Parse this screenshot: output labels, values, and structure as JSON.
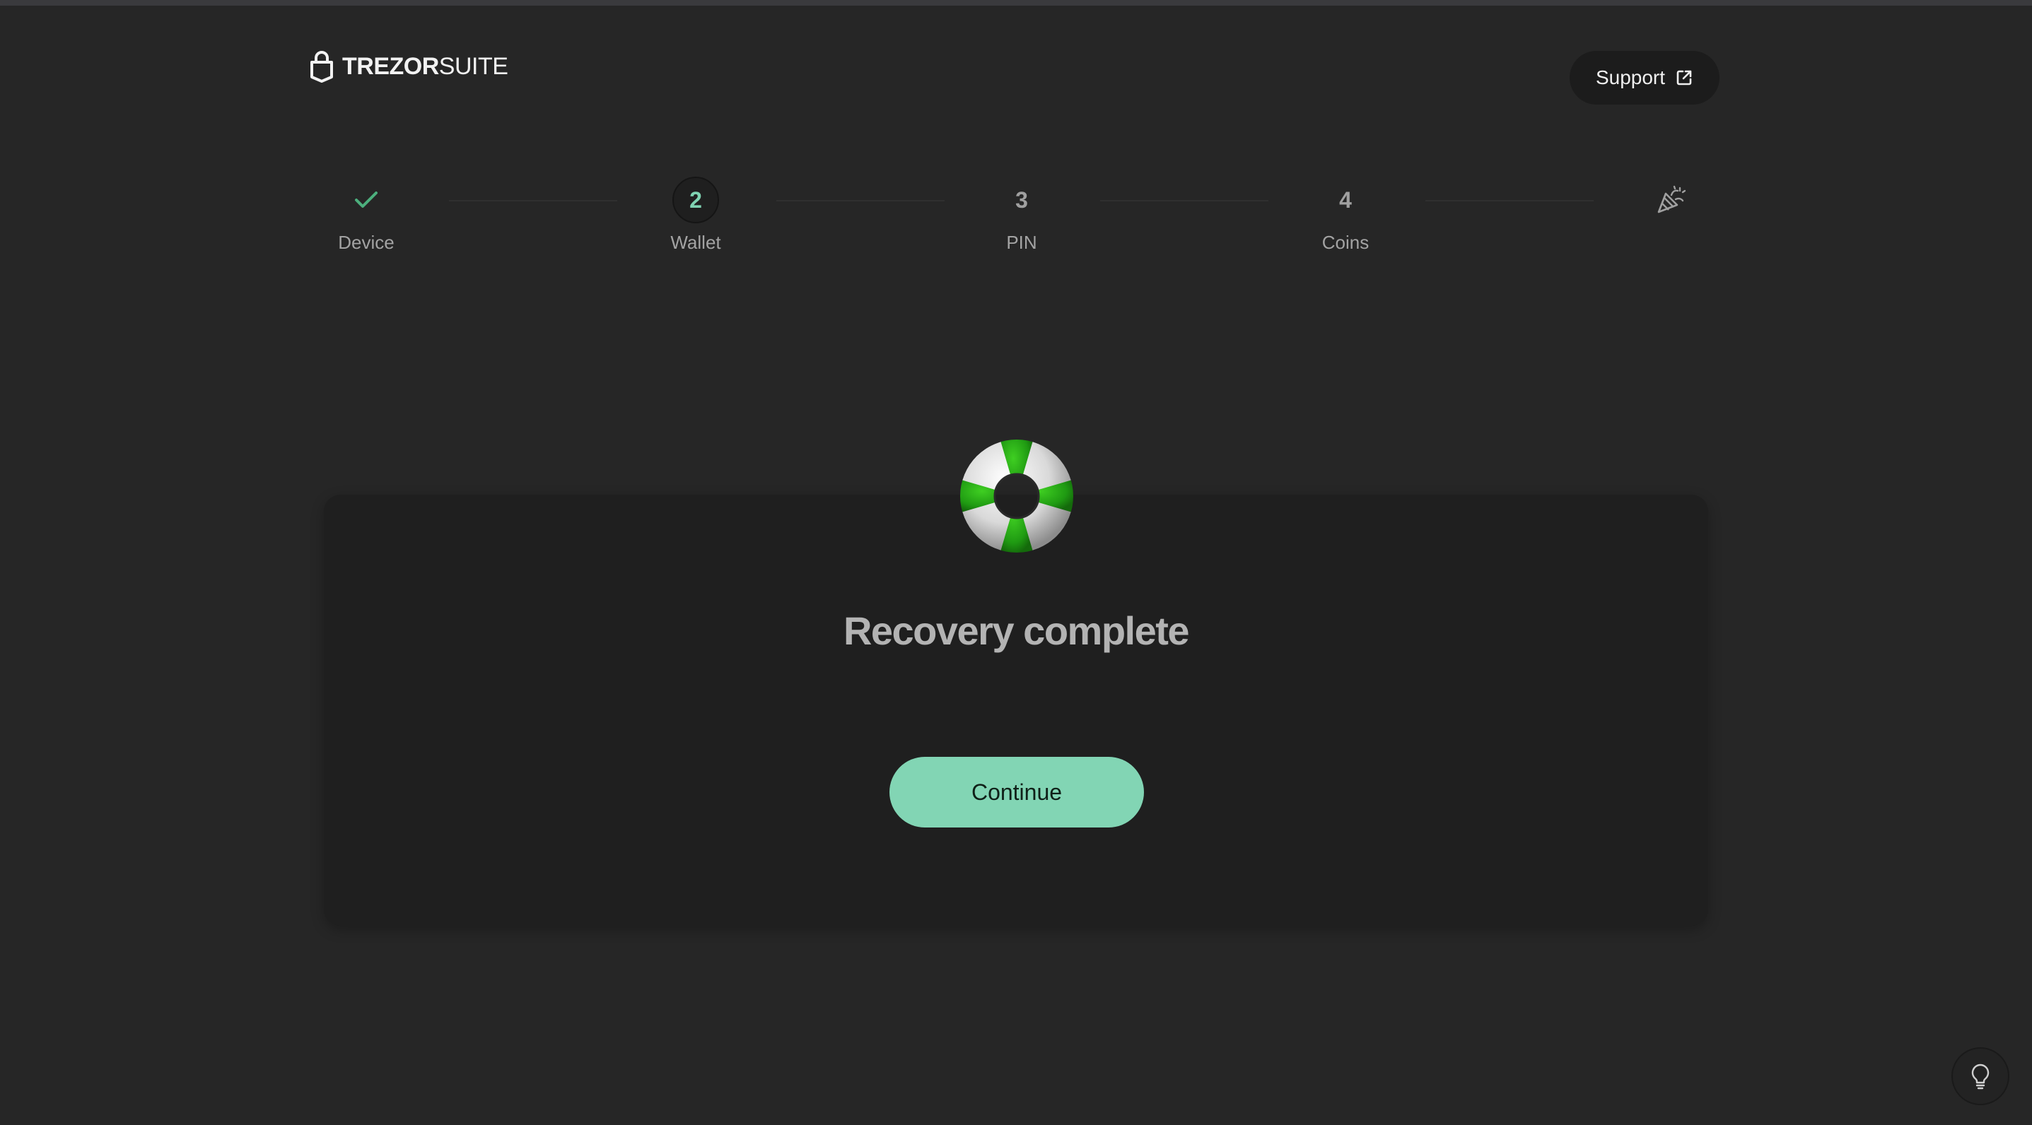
{
  "header": {
    "logo_bold": "TREZOR",
    "logo_light": "SUITE",
    "support_label": "Support"
  },
  "stepper": {
    "steps": [
      {
        "marker": "",
        "label": "Device",
        "state": "done"
      },
      {
        "marker": "2",
        "label": "Wallet",
        "state": "active"
      },
      {
        "marker": "3",
        "label": "PIN",
        "state": "pending"
      },
      {
        "marker": "4",
        "label": "Coins",
        "state": "pending"
      },
      {
        "marker": "",
        "label": "",
        "state": "final",
        "icon": "party-popper-icon"
      }
    ]
  },
  "main": {
    "title": "Recovery complete",
    "continue_label": "Continue",
    "illustration": "lifebuoy-icon"
  },
  "colors": {
    "background": "#262626",
    "card": "#1f1f1f",
    "accent": "#82d5b4",
    "check": "#4caf7d"
  },
  "footer": {
    "tip_icon": "lightbulb-icon"
  }
}
